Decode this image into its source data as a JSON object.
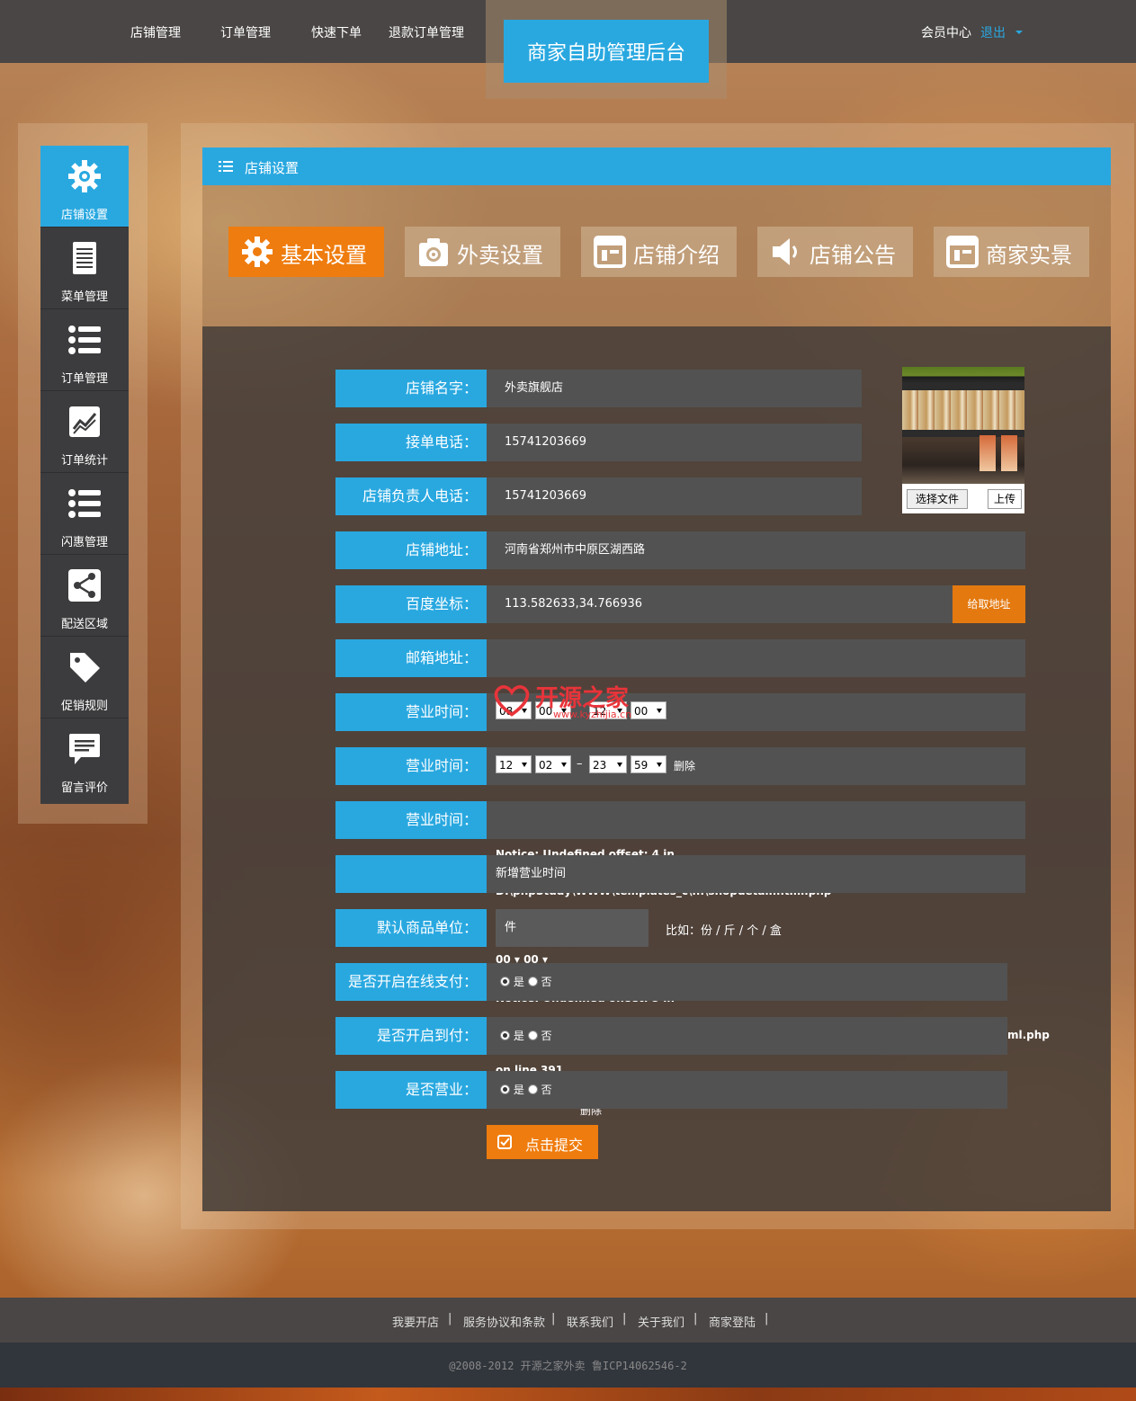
{
  "topnav": {
    "items": [
      "店铺管理",
      "订单管理",
      "快速下单",
      "退款订单管理"
    ],
    "brand": "商家自助管理后台",
    "member": "会员中心",
    "logout": "退出"
  },
  "sidebar": {
    "items": [
      {
        "label": "店铺设置",
        "icon": "gear-icon",
        "active": true
      },
      {
        "label": "菜单管理",
        "icon": "document-icon"
      },
      {
        "label": "订单管理",
        "icon": "list-icon"
      },
      {
        "label": "订单统计",
        "icon": "chart-icon"
      },
      {
        "label": "闪惠管理",
        "icon": "list-icon"
      },
      {
        "label": "配送区域",
        "icon": "share-icon"
      },
      {
        "label": "促销规则",
        "icon": "tag-icon"
      },
      {
        "label": "留言评价",
        "icon": "comment-icon"
      }
    ]
  },
  "panel": {
    "title": "店铺设置",
    "tabs": [
      {
        "label": "基本设置",
        "icon": "gear-icon",
        "active": true
      },
      {
        "label": "外卖设置",
        "icon": "camera-gear-icon"
      },
      {
        "label": "店铺介绍",
        "icon": "window-icon"
      },
      {
        "label": "店铺公告",
        "icon": "speaker-icon"
      },
      {
        "label": "商家实景",
        "icon": "window-icon"
      }
    ]
  },
  "form": {
    "shop_name": {
      "label": "店铺名字：",
      "value": "外卖旗舰店"
    },
    "order_phone": {
      "label": "接单电话：",
      "value": "15741203669"
    },
    "owner_phone": {
      "label": "店铺负责人电话：",
      "value": "15741203669"
    },
    "address": {
      "label": "店铺地址：",
      "value": "河南省郑州市中原区湖西路"
    },
    "coords": {
      "label": "百度坐标：",
      "value": "113.582633,34.766936",
      "button": "给取地址"
    },
    "email": {
      "label": "邮箱地址：",
      "value": ""
    },
    "hours1": {
      "label": "营业时间：",
      "start_h": "08",
      "start_m": "00",
      "end_h": "12",
      "end_m": "00"
    },
    "hours2": {
      "label": "营业时间：",
      "start_h": "12",
      "start_m": "02",
      "end_h": "23",
      "end_m": "59",
      "dash": "–",
      "delete": "删除"
    },
    "hours3": {
      "label": "营业时间："
    },
    "add_hours": "新增营业时间",
    "unit": {
      "label": "默认商品单位：",
      "value": "件",
      "hint": "比如：份 / 斤 / 个 / 盒"
    },
    "online_pay": {
      "label": "是否开启在线支付：",
      "yes": "是",
      "no": "否"
    },
    "cod": {
      "label": "是否开启到付：",
      "yes": "是",
      "no": "否"
    },
    "open": {
      "label": "是否营业：",
      "yes": "是",
      "no": "否"
    },
    "submit": "点击提交",
    "photo": {
      "choose_file": "选择文件",
      "upload": "上传"
    }
  },
  "notices": {
    "line1": "Notice: Undefined offset: 4 in",
    "line2": "D:\\phpStudy\\WWW\\templates_c\\...\\shopdetail.html.php",
    "line3": "00 ▾  00 ▾",
    "line4": "Notice: Undefined offset: 5 in",
    "line5": "ml.php",
    "line6": "on line 391",
    "line7": "删除"
  },
  "watermark": {
    "text": "开源之家",
    "url": "www.kyzhijia.cn"
  },
  "footer": {
    "links": [
      "我要开店",
      "服务协议和条款",
      "联系我们",
      "关于我们",
      "商家登陆"
    ],
    "copyright": "@2008-2012 开源之家外卖 鲁ICP14062546-2"
  },
  "colors": {
    "accent": "#29a8e0",
    "orange": "#ef7c0e",
    "dark": "#4a4645"
  }
}
